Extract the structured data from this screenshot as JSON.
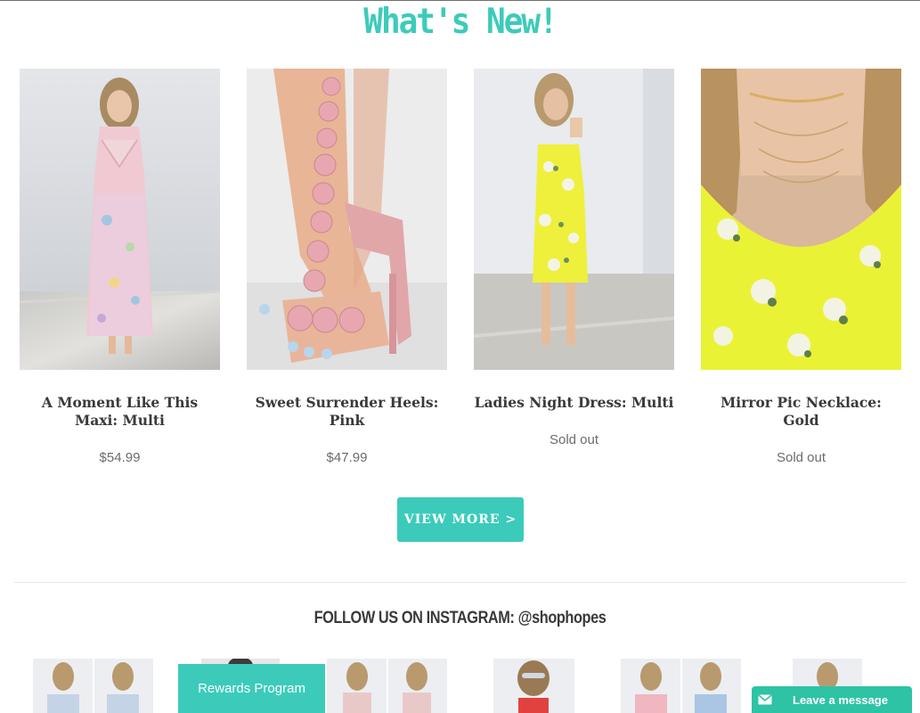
{
  "section": {
    "title": "What's New!"
  },
  "products": [
    {
      "name": "A Moment Like This Maxi: Multi",
      "price": "$54.99"
    },
    {
      "name": "Sweet Surrender Heels: Pink",
      "price": "$47.99"
    },
    {
      "name": "Ladies Night Dress: Multi",
      "price": "Sold out"
    },
    {
      "name": "Mirror Pic Necklace: Gold",
      "price": "Sold out"
    }
  ],
  "view_more": {
    "label": "VIEW MORE >"
  },
  "instagram": {
    "title": "FOLLOW US ON INSTAGRAM: @shophopes"
  },
  "rewards": {
    "label": "Rewards Program"
  },
  "chat": {
    "label": "Leave a message",
    "icon": "mail-icon"
  },
  "colors": {
    "accent": "#3ccbba",
    "chat": "#2ec3a5"
  }
}
